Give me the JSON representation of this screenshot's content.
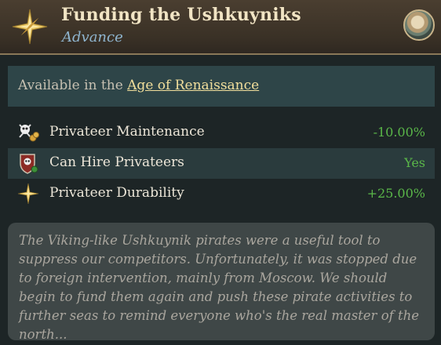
{
  "header": {
    "title": "Funding the Ushkuyniks",
    "subtitle": "Advance",
    "icon": "star-icon",
    "portrait": "advisor-portrait"
  },
  "availability": {
    "prefix": "Available in the ",
    "age": "Age of Renaissance"
  },
  "modifiers": [
    {
      "icon": "skull-coins-icon",
      "label": "Privateer Maintenance",
      "value": "-10.00%"
    },
    {
      "icon": "pirate-shield-icon",
      "label": "Can Hire Privateers",
      "value": "Yes"
    },
    {
      "icon": "star-icon",
      "label": "Privateer Durability",
      "value": "+25.00%"
    }
  ],
  "flavor_text": "The Viking-like Ushkuynik pirates were a useful tool to suppress our competitors. Unfortunately, it was stopped due to foreign intervention, mainly from Moscow. We should begin to fund them again and push these pirate activities to further seas to remind everyone who's the real master of the north...",
  "colors": {
    "positive": "#5ab749",
    "link": "#f2df9c",
    "subtitle": "#8fb5cf"
  }
}
